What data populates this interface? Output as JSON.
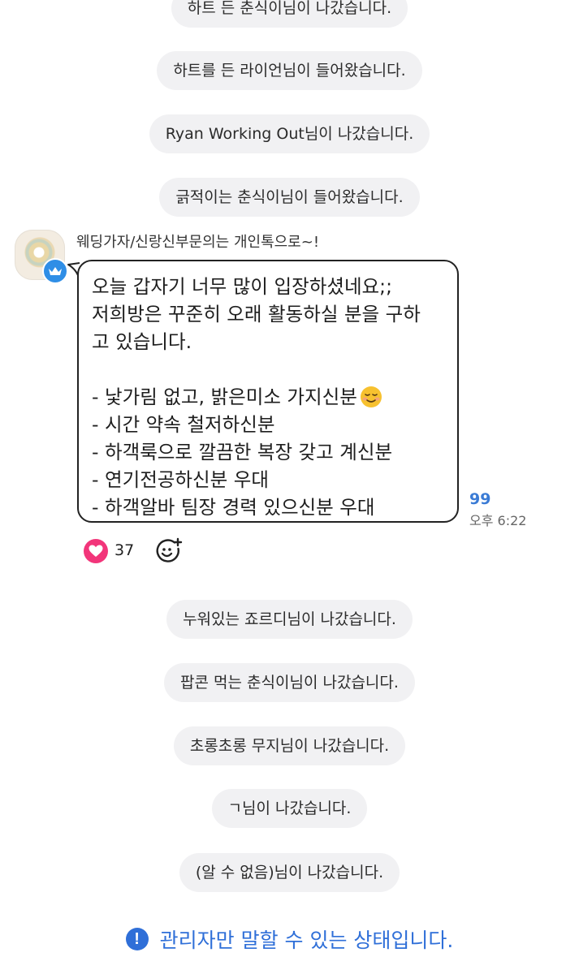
{
  "system_messages_top": [
    "하트 든 춘식이님이 나갔습니다.",
    "하트를 든 라이언님이 들어왔습니다.",
    "Ryan Working Out님이 나갔습니다.",
    "긁적이는 춘식이님이 들어왔습니다."
  ],
  "message": {
    "sender": "웨딩가자/신랑신부문의는 개인톡으로~!",
    "avatar_badge_icon": "crown-icon",
    "lines": [
      "오늘 갑자기 너무 많이 입장하셨네요;;",
      "저희방은 꾸준히 오래 활동하실 분을 구하",
      "고 있습니다.",
      "",
      "- 낯가림 없고, 밝은미소 가지신분",
      "- 시간 약속 철저하신분",
      "- 하객룩으로 깔끔한 복장 갖고 계신분",
      "- 연기전공하신분 우대",
      "- 하객알바 팀장 경력 있으신분 우대"
    ],
    "emoji_icon": "smiling-face-icon",
    "read_count": "99",
    "time": "오후 6:22",
    "reaction": {
      "icon": "heart-icon",
      "count": "37",
      "add_icon": "add-emoji-icon"
    }
  },
  "system_messages_bottom": [
    "누워있는 죠르디님이 나갔습니다.",
    "팝콘 먹는 춘식이님이 나갔습니다.",
    "초롱초롱 무지님이 나갔습니다.",
    "ㄱ님이 나갔습니다.",
    "(알 수 없음)님이 나갔습니다."
  ],
  "notice": {
    "icon": "exclamation-icon",
    "text": "관리자만 말할 수 있는 상태입니다."
  },
  "colors": {
    "system_pill_bg": "#f1f1f3",
    "accent_blue": "#2f6fd8",
    "read_count_blue": "#3a7bd5",
    "heart_pink": "#f2357a",
    "badge_blue": "#2f8ee6"
  }
}
